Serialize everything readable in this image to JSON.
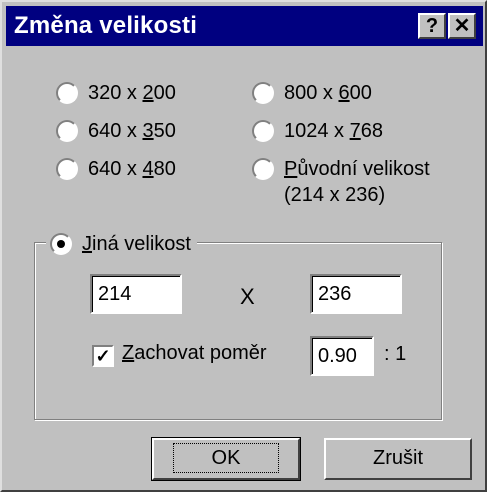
{
  "window": {
    "title": "Změna velikosti",
    "help_button": "?",
    "close_button": "✕"
  },
  "size_options": [
    {
      "pre": "320 x ",
      "hk": "2",
      "post": "00",
      "selected": false
    },
    {
      "pre": "640 x ",
      "hk": "3",
      "post": "50",
      "selected": false
    },
    {
      "pre": "640 x ",
      "hk": "4",
      "post": "80",
      "selected": false
    },
    {
      "pre": "800 x ",
      "hk": "6",
      "post": "00",
      "selected": false
    },
    {
      "pre": "1024 x ",
      "hk": "7",
      "post": "68",
      "selected": false
    }
  ],
  "original_size": {
    "hk": "P",
    "rest": "ůvodní velikost",
    "line2": "(214 x 236)",
    "selected": false
  },
  "custom_size": {
    "hk": "J",
    "rest": "iná velikost",
    "selected": true,
    "width": "214",
    "height": "236",
    "separator": "X"
  },
  "keep_ratio": {
    "checked": true,
    "check_mark": "✓",
    "hk": "Z",
    "rest": "achovat poměr",
    "value": "0.90",
    "suffix": ":   1"
  },
  "buttons": {
    "ok": "OK",
    "cancel": "Zrušit"
  }
}
